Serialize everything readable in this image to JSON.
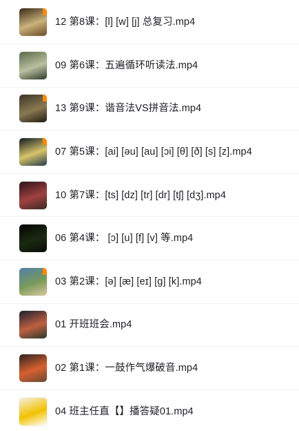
{
  "files": [
    {
      "name": "12 第8课：[l] [w] [j] 总复习.mp4",
      "thumb_colors": [
        "#3a2a1a",
        "#c9b27a",
        "#6b4a2a"
      ],
      "badge": true
    },
    {
      "name": "09 第6课：五遍循环听读法.mp4",
      "thumb_colors": [
        "#5a6a4a",
        "#b8c0a0",
        "#2e3a2a"
      ],
      "badge": false
    },
    {
      "name": "13 第9课：谐音法VS拼音法.mp4",
      "thumb_colors": [
        "#3c3326",
        "#8a7a52",
        "#1f1a14"
      ],
      "badge": true
    },
    {
      "name": "07 第5课：[ai] [əu] [au] [ɔi] [θ] [ð] [s] [z].mp4",
      "thumb_colors": [
        "#0d1a22",
        "#d8c46a",
        "#24384a"
      ],
      "badge": true
    },
    {
      "name": "10 第7课：[ts] [dz] [tr] [dr] [tʃ] [dʒ].mp4",
      "thumb_colors": [
        "#2a1418",
        "#a04040",
        "#3a2a20"
      ],
      "badge": false
    },
    {
      "name": "06 第4课： [ɔ] [u] [f] [v] 等.mp4",
      "thumb_colors": [
        "#050505",
        "#1a2a10",
        "#0a0a0a"
      ],
      "badge": false
    },
    {
      "name": "03 第2课：[ə] [æ] [eɪ] [g] [k].mp4",
      "thumb_colors": [
        "#4f7fa8",
        "#7a9a5a",
        "#d8c8a0"
      ],
      "badge": true
    },
    {
      "name": "01 开班班会.mp4",
      "thumb_colors": [
        "#1a2030",
        "#c06040",
        "#2a3a2a"
      ],
      "badge": false
    },
    {
      "name": "02 第1课：一鼓作气爆破音.mp4",
      "thumb_colors": [
        "#2a2420",
        "#d86030",
        "#6a4a30"
      ],
      "badge": false
    },
    {
      "name": "04 班主任直【】播答疑01.mp4",
      "thumb_colors": [
        "#f4f0e0",
        "#f2c200",
        "#ffffff"
      ],
      "badge": false
    }
  ]
}
